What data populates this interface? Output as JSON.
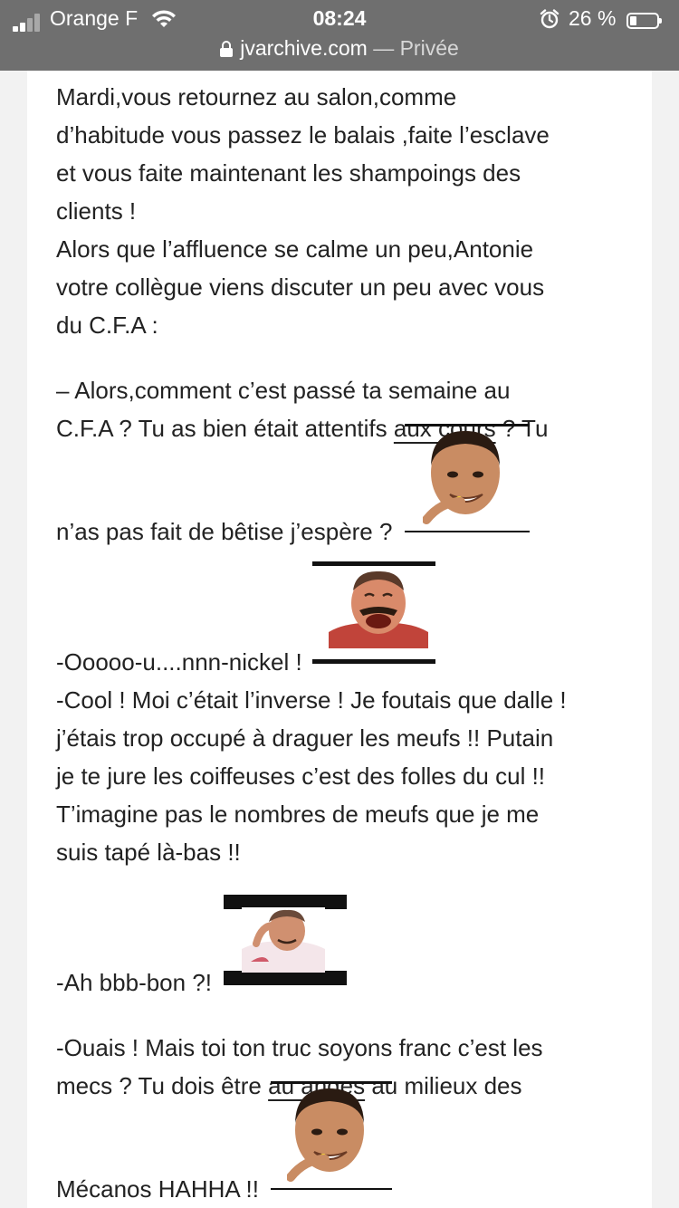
{
  "status": {
    "carrier": "Orange F",
    "time": "08:24",
    "battery": "26 %",
    "battery_level": 0.26
  },
  "browser": {
    "domain": "jvarchive.com",
    "separator": " — ",
    "mode": "Privée"
  },
  "story": {
    "p1": [
      "Mardi,vous retournez au salon,comme",
      "d’habitude vous passez le balais ,faite l’esclave",
      "et vous faite maintenant les shampoings des",
      "clients !",
      "Alors que l’affluence se calme un peu,Antonie",
      "votre collègue viens discuter un peu avec vous",
      "du C.F.A :"
    ],
    "p2_line1": "– Alors,comment c’est passé ta semaine au",
    "p2_line2_a": "C.F.A ? Tu as bien était attentifs ",
    "p2_line2_u": "aux cours",
    "p2_line2_b": " ? Tu",
    "p2_line3": "n’as pas fait de bêtise j’espère ?",
    "p3_line1": "-Ooooo-u....nnn-nickel !",
    "p3_rest": [
      "-Cool ! Moi c’était l’inverse ! Je foutais que dalle !",
      "j’étais trop occupé à draguer les meufs !! Putain",
      "je te jure les coiffeuses c’est des folles du cul !!",
      "T’imagine pas le nombres de meufs que je me",
      "suis tapé là-bas !!"
    ],
    "p4_line1": "-Ah bbb-bon ?!",
    "p5_line1": "-Ouais ! Mais toi ton truc soyons franc c’est les",
    "p5_line2_a": "mecs ? Tu dois être ",
    "p5_line2_u": "au anges",
    "p5_line2_b": " au milieux des",
    "p5_line3": "Mécanos HAHHA !!"
  },
  "stickers": {
    "s1": "ronaldo-smirk-sticker",
    "s2": "risitas-laugh-sticker",
    "s3": "risitas-cry-sticker",
    "s4": "ronaldo-smirk-sticker"
  }
}
